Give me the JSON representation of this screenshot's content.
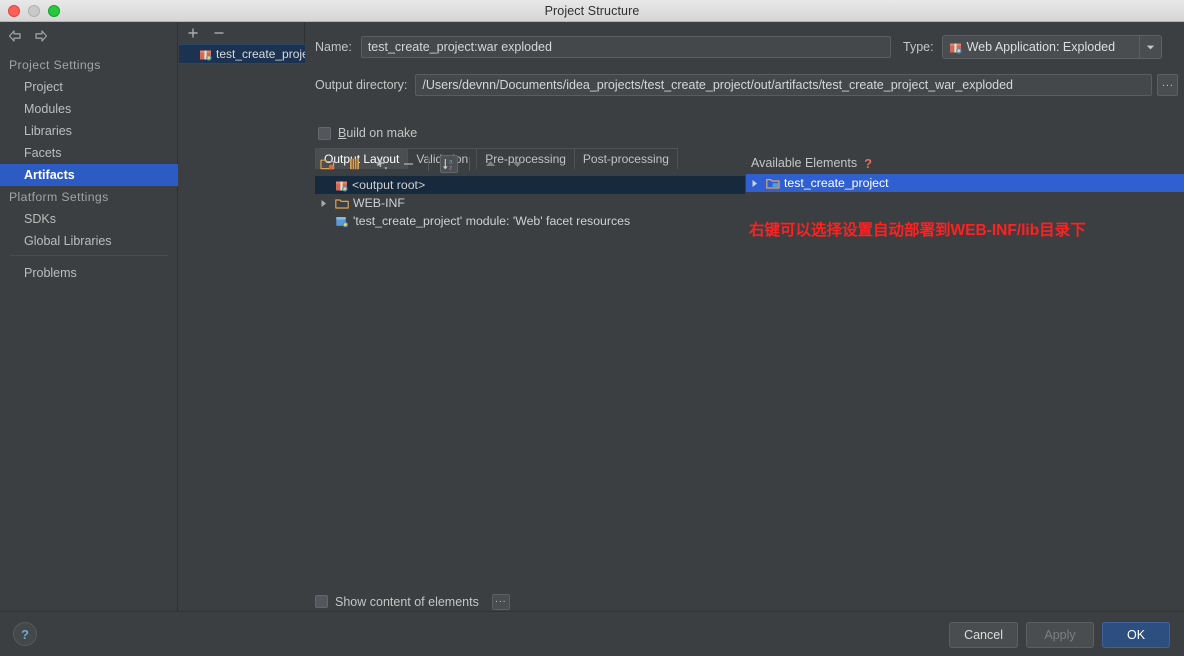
{
  "window": {
    "title": "Project Structure",
    "traffic_lights": [
      "close-button",
      "minimize-button",
      "maximize-button"
    ]
  },
  "sidebar": {
    "nav": {
      "back": "back-arrow-icon",
      "forward": "forward-arrow-icon"
    },
    "groups": [
      {
        "header": "Project Settings",
        "items": [
          {
            "label": "Project",
            "selected": false
          },
          {
            "label": "Modules",
            "selected": false
          },
          {
            "label": "Libraries",
            "selected": false
          },
          {
            "label": "Facets",
            "selected": false
          },
          {
            "label": "Artifacts",
            "selected": true
          }
        ]
      },
      {
        "header": "Platform Settings",
        "items": [
          {
            "label": "SDKs",
            "selected": false
          },
          {
            "label": "Global Libraries",
            "selected": false
          }
        ]
      }
    ],
    "problems_label": "Problems"
  },
  "artifact_panel": {
    "toolbar": {
      "add": "+",
      "remove": "−"
    },
    "items": [
      {
        "label": "test_create_proje",
        "icon": "artifact-icon",
        "selected": true
      }
    ]
  },
  "form": {
    "name_label": "Name:",
    "name_value": "test_create_project:war exploded",
    "type_label": "Type:",
    "type_value": "Web Application: Exploded",
    "output_dir_label": "Output directory:",
    "output_dir_value": "/Users/devnn/Documents/idea_projects/test_create_project/out/artifacts/test_create_project_war_exploded",
    "browse_label": "...",
    "build_on_make_label": "Build on make",
    "build_on_make_checked": false
  },
  "tabs": [
    {
      "label": "Output Layout",
      "active": true
    },
    {
      "label": "Validation",
      "active": false
    },
    {
      "label": "Pre-processing",
      "active": false
    },
    {
      "label": "Post-processing",
      "active": false
    }
  ],
  "layout_toolbar": [
    {
      "name": "create-directory-icon",
      "pressed": false
    },
    {
      "name": "create-archive-icon",
      "pressed": false
    },
    {
      "name": "add-copy-icon",
      "pressed": false
    },
    {
      "name": "remove-icon",
      "pressed": false
    },
    {
      "name": "sort-alphabetically-icon",
      "pressed": true
    },
    {
      "name": "move-up-icon",
      "pressed": false
    },
    {
      "name": "move-down-icon",
      "pressed": false
    }
  ],
  "output_tree": [
    {
      "label": "<output root>",
      "icon": "artifact-icon",
      "depth": 0,
      "twisty": "none",
      "selected": true
    },
    {
      "label": "WEB-INF",
      "icon": "folder-icon",
      "depth": 0,
      "twisty": "collapsed",
      "selected": false
    },
    {
      "label": "'test_create_project' module: 'Web' facet resources",
      "icon": "facet-resource-icon",
      "depth": 1,
      "twisty": "none",
      "selected": false
    }
  ],
  "available_elements": {
    "title": "Available Elements",
    "help_icon": "help-question-icon",
    "items": [
      {
        "label": "test_create_project",
        "icon": "module-folder-icon",
        "twisty": "collapsed",
        "selected": true
      }
    ]
  },
  "annotation": {
    "text": "右键可以选择设置自动部署到WEB-INF/lib目录下",
    "color": "#ff2020"
  },
  "bottom": {
    "show_content_label": "Show content of elements",
    "show_content_checked": false,
    "show_content_ellipsis": "..."
  },
  "footer": {
    "help_label": "?",
    "buttons": [
      {
        "label": "Cancel",
        "style": "normal"
      },
      {
        "label": "Apply",
        "style": "disabled"
      },
      {
        "label": "OK",
        "style": "default"
      }
    ]
  },
  "colors": {
    "window_bg": "#3c3f41",
    "selection_blue": "#2d5bc4",
    "selection_dark": "#16293d",
    "accent_ok": "#2c4f80",
    "annotation_red": "#ff2020"
  }
}
